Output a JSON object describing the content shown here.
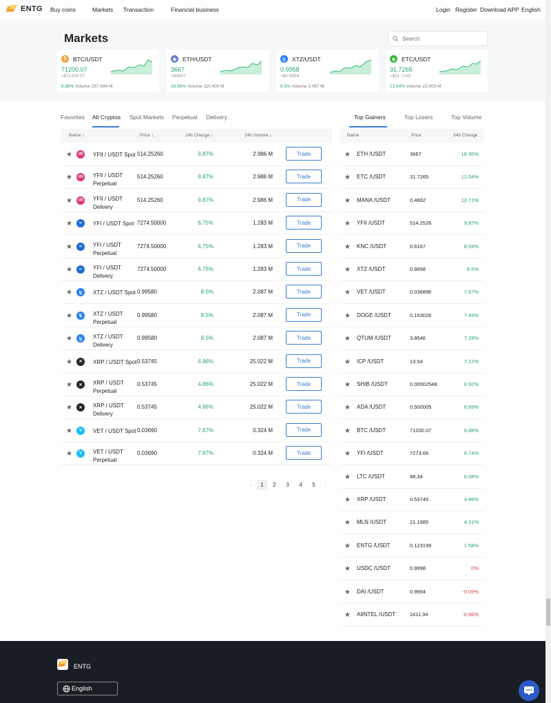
{
  "header": {
    "logo_text": "ENTG",
    "nav": [
      "Buy coins",
      "Markets",
      "Transaction",
      "Financial business"
    ],
    "login": "Login",
    "register": "Register",
    "download": "Download APP",
    "language": "English"
  },
  "page": {
    "title": "Markets",
    "search_placeholder": "Search"
  },
  "cards": [
    {
      "pair": "BTC/USDT",
      "price": "71200.07",
      "usd": "≈$71200.07",
      "change": "6.88%",
      "volume": "Volume 257.694 M",
      "coin_color": "#f2a33a",
      "coin_glyph": "₿"
    },
    {
      "pair": "ETH/USDT",
      "price": "3667",
      "usd": "≈$3667",
      "change": "18.95%",
      "volume": "Volume 110.400 M",
      "coin_color": "#6b7fd7",
      "coin_glyph": "◆"
    },
    {
      "pair": "XTZ/USDT",
      "price": "0.9958",
      "usd": "≈$0.9958",
      "change": "8.5%",
      "volume": "Volume 2.087 M",
      "coin_color": "#2c7df7",
      "coin_glyph": "ꜩ"
    },
    {
      "pair": "ETC/USDT",
      "price": "31.7265",
      "usd": "≈$31.7265",
      "change": "13.54%",
      "volume": "Volume 22.003 M",
      "coin_color": "#3ab83a",
      "coin_glyph": "◆"
    }
  ],
  "tabs": [
    "Favorites",
    "All Cryptos",
    "Spot Markets",
    "Perpetual",
    "Delivery"
  ],
  "table_headers": {
    "name": "Name ↕",
    "price": "Price ↕",
    "change": "24h Change ↕",
    "volume": "24h Volume ↕"
  },
  "trade_label": "Trade",
  "rows": [
    {
      "name": "YFII / USDT Spot",
      "price": "514.25260",
      "change": "9.87%",
      "volume": "2.986 M",
      "icon_color": "#e0337a",
      "glyph": "dfi"
    },
    {
      "name": "YFII / USDT Perpetual",
      "price": "514.25260",
      "change": "9.87%",
      "volume": "2.986 M",
      "icon_color": "#e0337a",
      "glyph": "dfi"
    },
    {
      "name": "YFII / USDT Delivery",
      "price": "514.25260",
      "change": "9.87%",
      "volume": "2.986 M",
      "icon_color": "#e0337a",
      "glyph": "dfi"
    },
    {
      "name": "YFI / USDT Spot",
      "price": "7274.50000",
      "change": "6.75%",
      "volume": "1.283 M",
      "icon_color": "#1e6bd6",
      "glyph": "∞"
    },
    {
      "name": "YFI / USDT Perpetual",
      "price": "7274.50000",
      "change": "6.75%",
      "volume": "1.283 M",
      "icon_color": "#1e6bd6",
      "glyph": "∞"
    },
    {
      "name": "YFI / USDT Delivery",
      "price": "7274.50000",
      "change": "6.75%",
      "volume": "1.283 M",
      "icon_color": "#1e6bd6",
      "glyph": "∞"
    },
    {
      "name": "XTZ / USDT Spot",
      "price": "0.99580",
      "change": "8.5%",
      "volume": "2.087 M",
      "icon_color": "#2c7df7",
      "glyph": "ꜩ"
    },
    {
      "name": "XTZ / USDT Perpetual",
      "price": "0.99580",
      "change": "8.5%",
      "volume": "2.087 M",
      "icon_color": "#2c7df7",
      "glyph": "ꜩ"
    },
    {
      "name": "XTZ / USDT Delivery",
      "price": "0.99580",
      "change": "8.5%",
      "volume": "2.087 M",
      "icon_color": "#2c7df7",
      "glyph": "ꜩ"
    },
    {
      "name": "XRP / USDT Spot",
      "price": "0.53745",
      "change": "4.86%",
      "volume": "25.022 M",
      "icon_color": "#23292f",
      "glyph": "✕"
    },
    {
      "name": "XRP / USDT Perpetual",
      "price": "0.53745",
      "change": "4.86%",
      "volume": "25.022 M",
      "icon_color": "#23292f",
      "glyph": "✕"
    },
    {
      "name": "XRP / USDT Delivery",
      "price": "0.53745",
      "change": "4.86%",
      "volume": "25.022 M",
      "icon_color": "#23292f",
      "glyph": "✕"
    },
    {
      "name": "VET / USDT Spot",
      "price": "0.03690",
      "change": "7.67%",
      "volume": "0.324 M",
      "icon_color": "#15bdff",
      "glyph": "V"
    },
    {
      "name": "VET / USDT Perpetual",
      "price": "0.03690",
      "change": "7.67%",
      "volume": "0.324 M",
      "icon_color": "#15bdff",
      "glyph": "V"
    }
  ],
  "pagination": [
    "1",
    "2",
    "3",
    "4",
    "5"
  ],
  "right_tabs": [
    "Top Gainers",
    "Top Losers",
    "Top Volume"
  ],
  "right_headers": {
    "name": "Name",
    "price": "Price",
    "change": "24h Change"
  },
  "gainers": [
    {
      "name": "ETH /USDT",
      "price": "3667",
      "change": "18.95%"
    },
    {
      "name": "ETC /USDT",
      "price": "31.7265",
      "change": "13.54%"
    },
    {
      "name": "MANA /USDT",
      "price": "0.4662",
      "change": "10.71%"
    },
    {
      "name": "YFII /USDT",
      "price": "514.2526",
      "change": "9.87%"
    },
    {
      "name": "KNC /USDT",
      "price": "0.6167",
      "change": "8.59%"
    },
    {
      "name": "XTZ /USDT",
      "price": "0.9958",
      "change": "8.5%"
    },
    {
      "name": "VET /USDT",
      "price": "0.036896",
      "change": "7.67%"
    },
    {
      "name": "DOGE /USDT",
      "price": "0.163026",
      "change": "7.49%"
    },
    {
      "name": "QTUM /USDT",
      "price": "3.8546",
      "change": "7.28%"
    },
    {
      "name": "ICP /USDT",
      "price": "13.54",
      "change": "7.12%"
    },
    {
      "name": "SHIB /USDT",
      "price": "0.00002548",
      "change": "6.92%"
    },
    {
      "name": "ADA /USDT",
      "price": "0.500005",
      "change": "6.89%"
    },
    {
      "name": "BTC /USDT",
      "price": "71200.07",
      "change": "6.88%"
    },
    {
      "name": "YFI /USDT",
      "price": "7273.66",
      "change": "6.74%"
    },
    {
      "name": "LTC /USDT",
      "price": "88.34",
      "change": "6.08%"
    },
    {
      "name": "XRP /USDT",
      "price": "0.53745",
      "change": "4.86%"
    },
    {
      "name": "MLN /USDT",
      "price": "21.1985",
      "change": "4.31%"
    },
    {
      "name": "ENTG /USDT",
      "price": "0.123199",
      "change": "1.58%"
    },
    {
      "name": "USDC /USDT",
      "price": "0.9998",
      "change": "0%"
    },
    {
      "name": "DAI /USDT",
      "price": "0.9994",
      "change": "-0.09%"
    },
    {
      "name": "AIINTEL /USDT",
      "price": "2411.94",
      "change": "-0.96%"
    }
  ],
  "footer": {
    "brand": "ENTG",
    "language": "English"
  },
  "colors": {
    "up": "#26a17b",
    "down": "#e04545",
    "accent": "#3a7bd5"
  }
}
